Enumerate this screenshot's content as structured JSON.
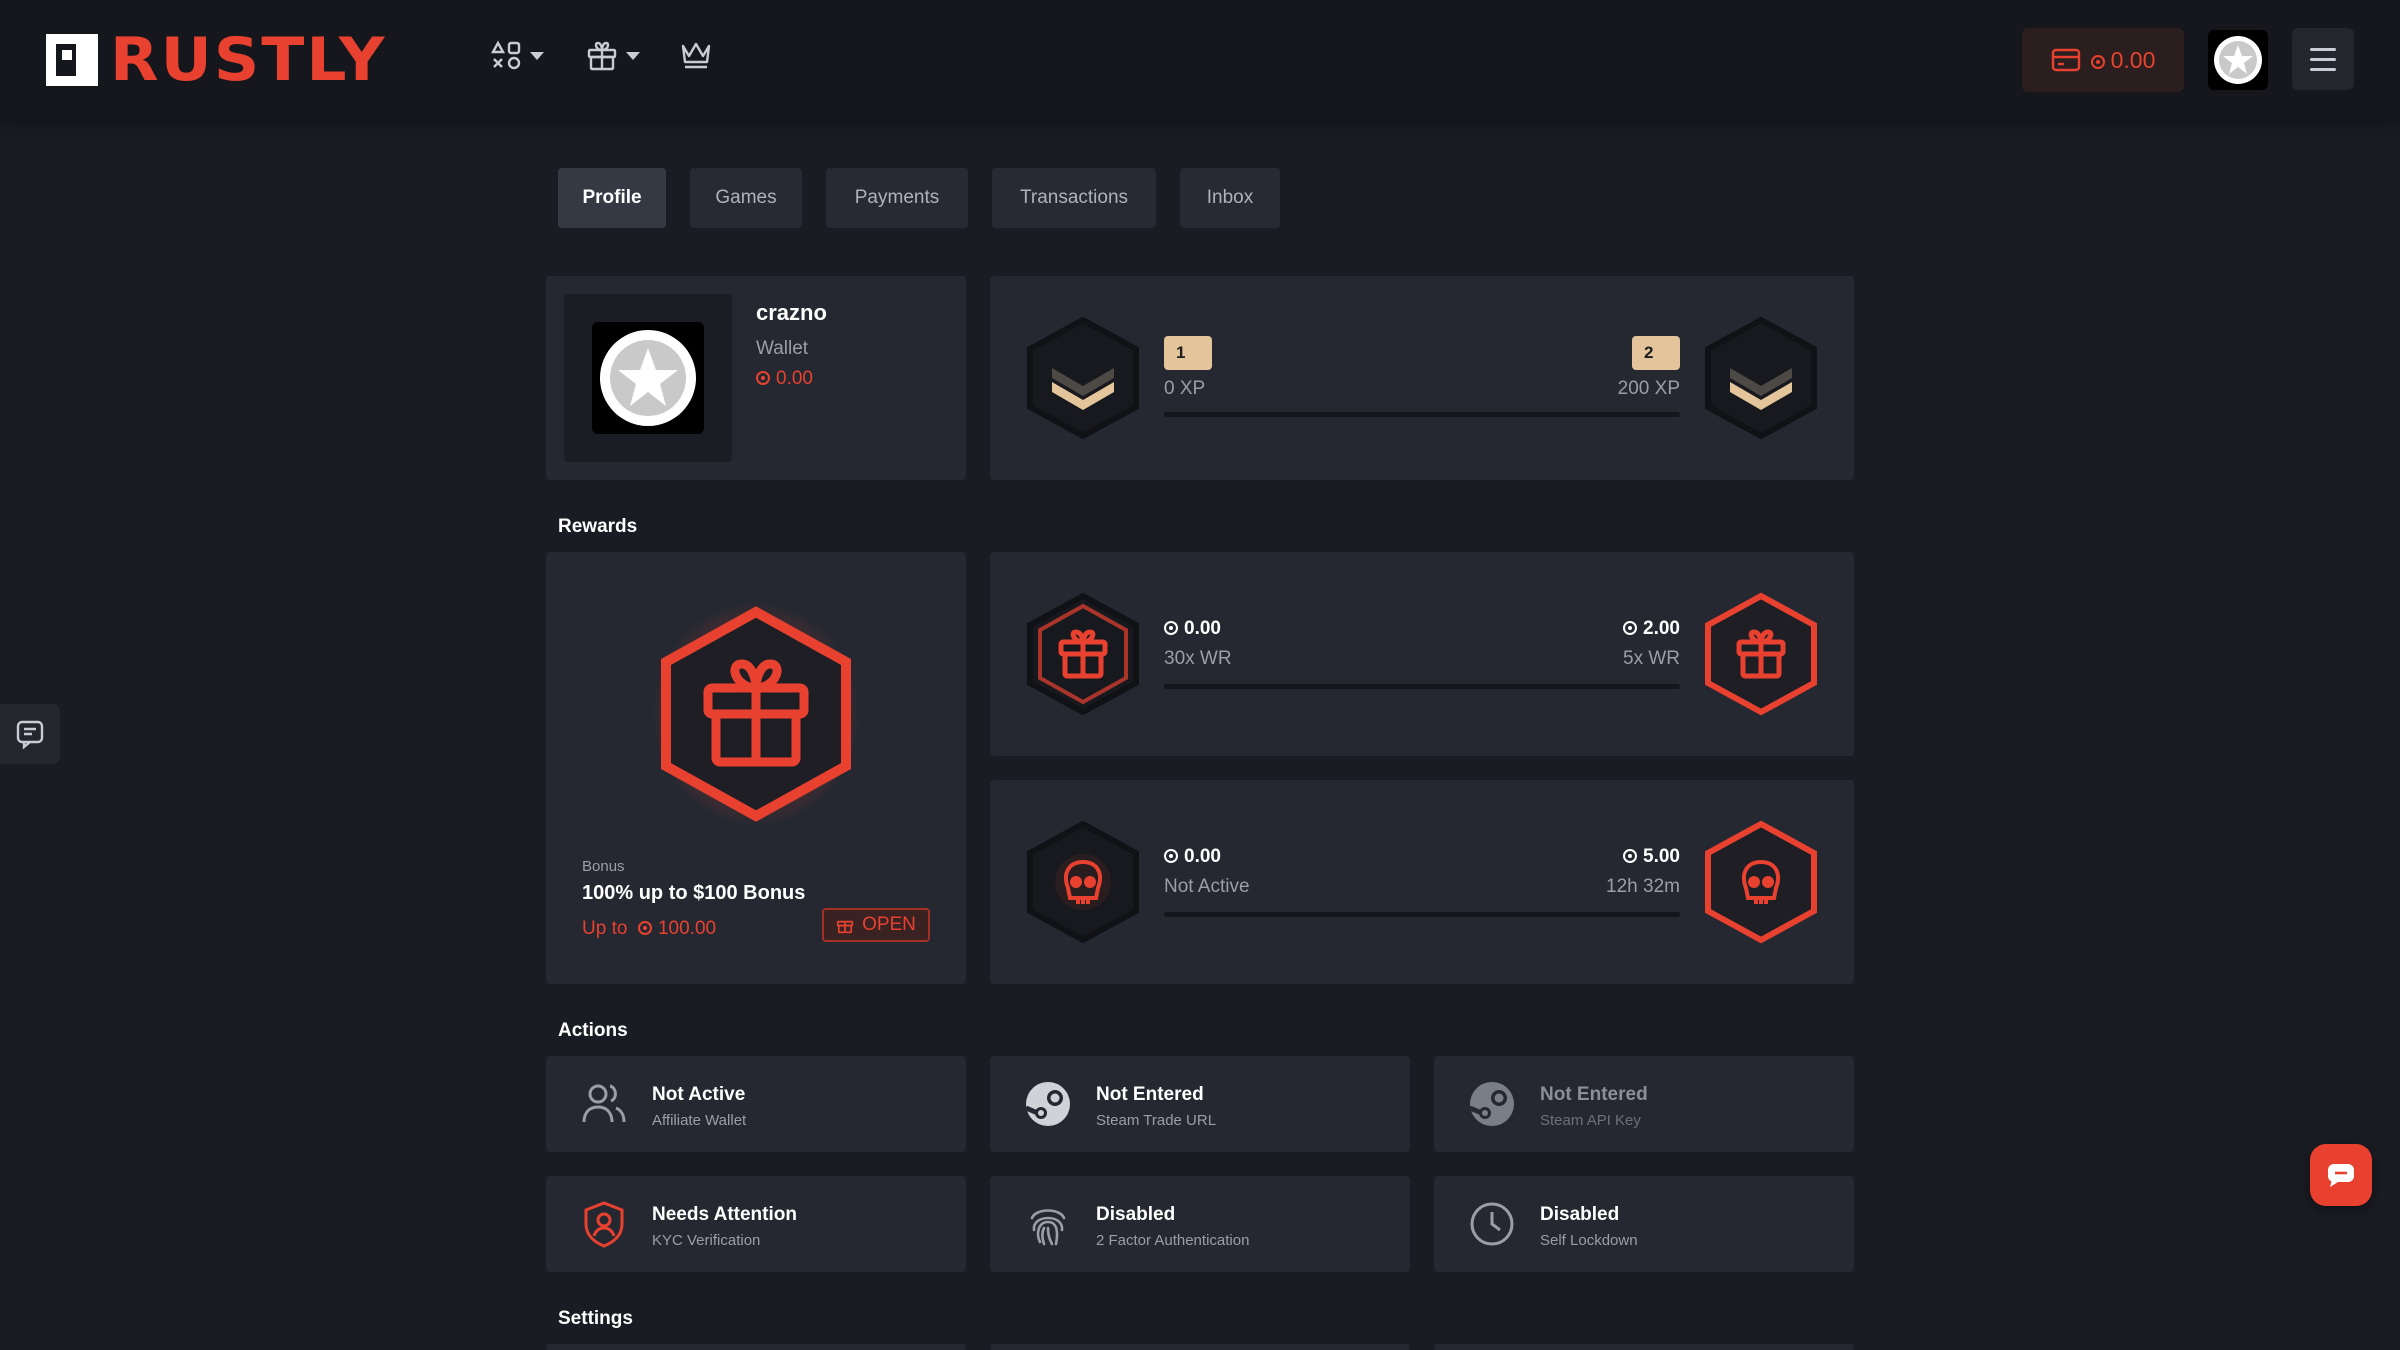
{
  "brand": {
    "name": "RUSTLY",
    "accent": "#e8412f"
  },
  "header": {
    "nav": [
      {
        "icon": "games-grid-icon",
        "has_dropdown": true
      },
      {
        "icon": "gift-icon",
        "has_dropdown": true
      },
      {
        "icon": "crown-icon",
        "has_dropdown": false
      }
    ],
    "balance": "0.00"
  },
  "tabs": [
    "Profile",
    "Games",
    "Payments",
    "Transactions",
    "Inbox"
  ],
  "profile": {
    "username": "crazno",
    "wallet_label": "Wallet",
    "wallet_value": "0.00"
  },
  "level": {
    "current_level": "1",
    "current_xp": "0 XP",
    "next_level": "2",
    "next_xp": "200 XP",
    "progress": 0
  },
  "rewards": {
    "title": "Rewards",
    "bonus": {
      "label": "Bonus",
      "title": "100% up to $100 Bonus",
      "upto_label": "Up to",
      "upto_value": "100.00",
      "open_label": "OPEN"
    },
    "wager": {
      "left_value": "0.00",
      "left_sub": "30x WR",
      "right_value": "2.00",
      "right_sub": "5x WR",
      "progress": 0
    },
    "rakeback": {
      "left_value": "0.00",
      "left_sub": "Not Active",
      "right_value": "5.00",
      "right_sub": "12h 32m",
      "progress": 0
    }
  },
  "actions": {
    "title": "Actions",
    "items": [
      {
        "title": "Not Active",
        "sub": "Affiliate Wallet",
        "icon": "users-icon"
      },
      {
        "title": "Not Entered",
        "sub": "Steam Trade URL",
        "icon": "steam-icon"
      },
      {
        "title": "Not Entered",
        "sub": "Steam API Key",
        "icon": "steam-icon"
      },
      {
        "title": "Needs Attention",
        "sub": "KYC Verification",
        "icon": "shield-user-icon"
      },
      {
        "title": "Disabled",
        "sub": "2 Factor Authentication",
        "icon": "fingerprint-icon"
      },
      {
        "title": "Disabled",
        "sub": "Self Lockdown",
        "icon": "clock-icon"
      }
    ]
  },
  "settings": {
    "title": "Settings"
  }
}
